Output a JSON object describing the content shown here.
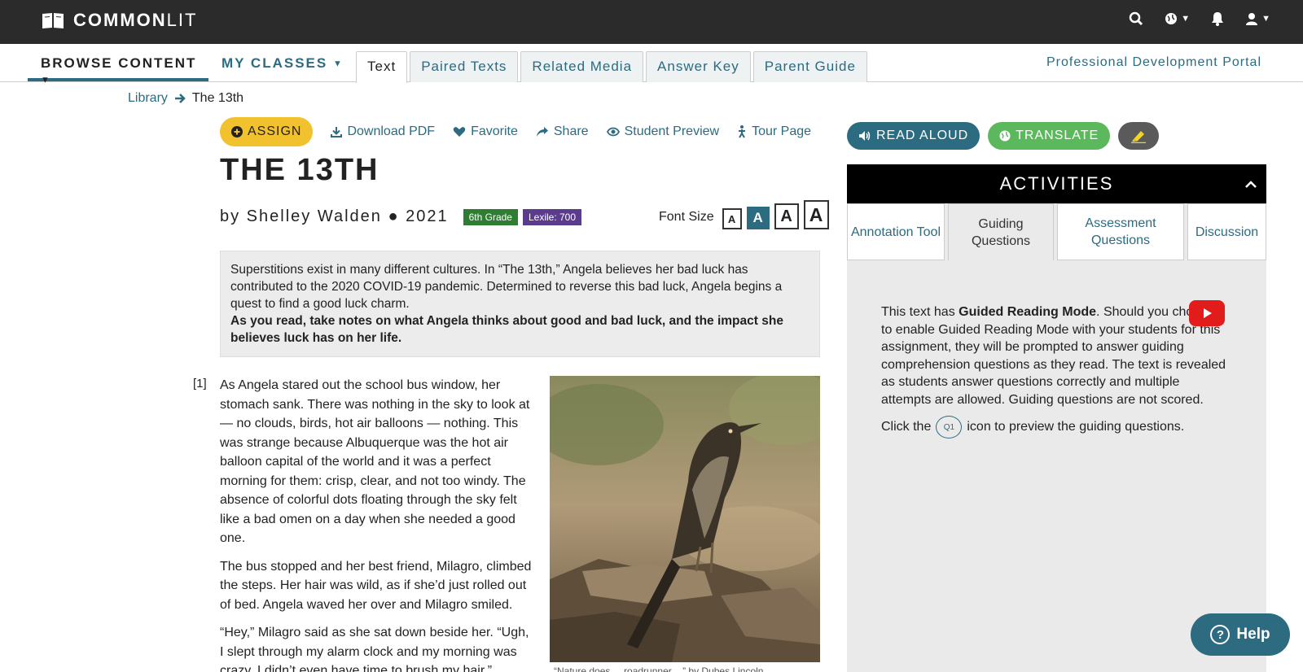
{
  "brand": {
    "name_bold": "COMMON",
    "name_light": "LIT"
  },
  "topbar": {
    "icons": [
      "search-icon",
      "globe-icon",
      "bell-icon",
      "user-icon"
    ]
  },
  "nav": {
    "browse": "BROWSE CONTENT",
    "classes": "MY CLASSES",
    "tabs": [
      "Text",
      "Paired Texts",
      "Related Media",
      "Answer Key",
      "Parent Guide"
    ],
    "active_tab": "Text",
    "pd_portal": "Professional Development Portal"
  },
  "breadcrumb": {
    "library": "Library",
    "current": "The 13th"
  },
  "actions": {
    "assign": "ASSIGN",
    "download": "Download PDF",
    "favorite": "Favorite",
    "share": "Share",
    "preview": "Student Preview",
    "tour": "Tour Page"
  },
  "text": {
    "title": "THE 13TH",
    "byline": "by Shelley Walden ● 2021",
    "grade": "6th Grade",
    "lexile": "Lexile: 700",
    "font_size_label": "Font Size",
    "font_size_glyph": "A",
    "intro": "Superstitions exist in many different cultures. In “The 13th,” Angela believes her bad luck has contributed to the 2020 COVID-19 pandemic. Determined to reverse this bad luck, Angela begins a quest to find a good luck charm.",
    "intro_bold": "As you read, take notes on what Angela thinks about good and bad luck, and the impact she believes luck has on her life.",
    "para_number": "[1]",
    "paragraphs": [
      "As Angela stared out the school bus window, her stomach sank. There was nothing in the sky to look at — no clouds, birds, hot air balloons — nothing. This was strange because Albuquerque was the hot air balloon capital of the world and it was a perfect morning for them: crisp, clear, and not too windy. The absence of colorful dots floating through the sky felt like a bad omen on a day when she needed a good one.",
      "The bus stopped and her best friend, Milagro, climbed the steps. Her hair was wild, as if she’d just rolled out of bed. Angela waved her over and Milagro smiled.",
      "“Hey,” Milagro said as she sat down beside her. “Ugh, I slept through my alarm clock and my morning was crazy. I didn’t even have time to brush my hair.”"
    ],
    "caption": "“Nature does ... roadrunner ...” by Dubes Lincoln"
  },
  "tools": {
    "read_aloud": "READ ALOUD",
    "translate": "TRANSLATE"
  },
  "activities": {
    "header": "ACTIVITIES",
    "tabs": [
      "Annotation Tool",
      "Guiding Questions",
      "Assessment Questions",
      "Discussion"
    ],
    "active_tab": "Guiding Questions",
    "guided_pre": "This text has ",
    "guided_bold": "Guided Reading Mode",
    "guided_post": ". Should you choose to enable Guided Reading Mode with your students for this assignment, they will be prompted to answer guiding comprehension questions as they read. The text is revealed as students answer questions correctly and multiple attempts are allowed. Guiding questions are not scored.",
    "click_pre": "Click the",
    "q1": "Q1",
    "click_post": "icon to preview the guiding questions."
  },
  "help": {
    "label": "Help"
  },
  "colors": {
    "accent": "#2c6b80",
    "assign": "#f2c12e",
    "translate": "#5cb85c",
    "topbar": "#2b2b2b"
  }
}
